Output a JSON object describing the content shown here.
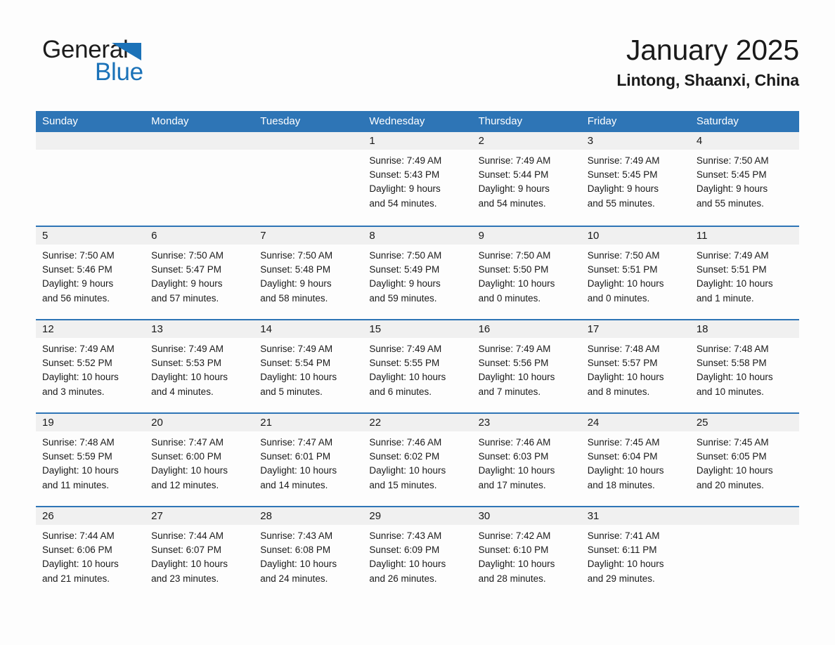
{
  "brand": {
    "name_part1": "General",
    "name_part2": "Blue",
    "triangle_icon": "triangle-icon",
    "accent_color": "#1b72b8"
  },
  "header": {
    "title": "January 2025",
    "subtitle": "Lintong, Shaanxi, China",
    "header_bg_color": "#2e75b6",
    "day_strip_color": "#f0f0f0"
  },
  "weekdays": [
    "Sunday",
    "Monday",
    "Tuesday",
    "Wednesday",
    "Thursday",
    "Friday",
    "Saturday"
  ],
  "weeks": [
    [
      {
        "date": "",
        "sunrise": "",
        "sunset": "",
        "daylight_line1": "",
        "daylight_line2": ""
      },
      {
        "date": "",
        "sunrise": "",
        "sunset": "",
        "daylight_line1": "",
        "daylight_line2": ""
      },
      {
        "date": "",
        "sunrise": "",
        "sunset": "",
        "daylight_line1": "",
        "daylight_line2": ""
      },
      {
        "date": "1",
        "sunrise": "Sunrise: 7:49 AM",
        "sunset": "Sunset: 5:43 PM",
        "daylight_line1": "Daylight: 9 hours",
        "daylight_line2": "and 54 minutes."
      },
      {
        "date": "2",
        "sunrise": "Sunrise: 7:49 AM",
        "sunset": "Sunset: 5:44 PM",
        "daylight_line1": "Daylight: 9 hours",
        "daylight_line2": "and 54 minutes."
      },
      {
        "date": "3",
        "sunrise": "Sunrise: 7:49 AM",
        "sunset": "Sunset: 5:45 PM",
        "daylight_line1": "Daylight: 9 hours",
        "daylight_line2": "and 55 minutes."
      },
      {
        "date": "4",
        "sunrise": "Sunrise: 7:50 AM",
        "sunset": "Sunset: 5:45 PM",
        "daylight_line1": "Daylight: 9 hours",
        "daylight_line2": "and 55 minutes."
      }
    ],
    [
      {
        "date": "5",
        "sunrise": "Sunrise: 7:50 AM",
        "sunset": "Sunset: 5:46 PM",
        "daylight_line1": "Daylight: 9 hours",
        "daylight_line2": "and 56 minutes."
      },
      {
        "date": "6",
        "sunrise": "Sunrise: 7:50 AM",
        "sunset": "Sunset: 5:47 PM",
        "daylight_line1": "Daylight: 9 hours",
        "daylight_line2": "and 57 minutes."
      },
      {
        "date": "7",
        "sunrise": "Sunrise: 7:50 AM",
        "sunset": "Sunset: 5:48 PM",
        "daylight_line1": "Daylight: 9 hours",
        "daylight_line2": "and 58 minutes."
      },
      {
        "date": "8",
        "sunrise": "Sunrise: 7:50 AM",
        "sunset": "Sunset: 5:49 PM",
        "daylight_line1": "Daylight: 9 hours",
        "daylight_line2": "and 59 minutes."
      },
      {
        "date": "9",
        "sunrise": "Sunrise: 7:50 AM",
        "sunset": "Sunset: 5:50 PM",
        "daylight_line1": "Daylight: 10 hours",
        "daylight_line2": "and 0 minutes."
      },
      {
        "date": "10",
        "sunrise": "Sunrise: 7:50 AM",
        "sunset": "Sunset: 5:51 PM",
        "daylight_line1": "Daylight: 10 hours",
        "daylight_line2": "and 0 minutes."
      },
      {
        "date": "11",
        "sunrise": "Sunrise: 7:49 AM",
        "sunset": "Sunset: 5:51 PM",
        "daylight_line1": "Daylight: 10 hours",
        "daylight_line2": "and 1 minute."
      }
    ],
    [
      {
        "date": "12",
        "sunrise": "Sunrise: 7:49 AM",
        "sunset": "Sunset: 5:52 PM",
        "daylight_line1": "Daylight: 10 hours",
        "daylight_line2": "and 3 minutes."
      },
      {
        "date": "13",
        "sunrise": "Sunrise: 7:49 AM",
        "sunset": "Sunset: 5:53 PM",
        "daylight_line1": "Daylight: 10 hours",
        "daylight_line2": "and 4 minutes."
      },
      {
        "date": "14",
        "sunrise": "Sunrise: 7:49 AM",
        "sunset": "Sunset: 5:54 PM",
        "daylight_line1": "Daylight: 10 hours",
        "daylight_line2": "and 5 minutes."
      },
      {
        "date": "15",
        "sunrise": "Sunrise: 7:49 AM",
        "sunset": "Sunset: 5:55 PM",
        "daylight_line1": "Daylight: 10 hours",
        "daylight_line2": "and 6 minutes."
      },
      {
        "date": "16",
        "sunrise": "Sunrise: 7:49 AM",
        "sunset": "Sunset: 5:56 PM",
        "daylight_line1": "Daylight: 10 hours",
        "daylight_line2": "and 7 minutes."
      },
      {
        "date": "17",
        "sunrise": "Sunrise: 7:48 AM",
        "sunset": "Sunset: 5:57 PM",
        "daylight_line1": "Daylight: 10 hours",
        "daylight_line2": "and 8 minutes."
      },
      {
        "date": "18",
        "sunrise": "Sunrise: 7:48 AM",
        "sunset": "Sunset: 5:58 PM",
        "daylight_line1": "Daylight: 10 hours",
        "daylight_line2": "and 10 minutes."
      }
    ],
    [
      {
        "date": "19",
        "sunrise": "Sunrise: 7:48 AM",
        "sunset": "Sunset: 5:59 PM",
        "daylight_line1": "Daylight: 10 hours",
        "daylight_line2": "and 11 minutes."
      },
      {
        "date": "20",
        "sunrise": "Sunrise: 7:47 AM",
        "sunset": "Sunset: 6:00 PM",
        "daylight_line1": "Daylight: 10 hours",
        "daylight_line2": "and 12 minutes."
      },
      {
        "date": "21",
        "sunrise": "Sunrise: 7:47 AM",
        "sunset": "Sunset: 6:01 PM",
        "daylight_line1": "Daylight: 10 hours",
        "daylight_line2": "and 14 minutes."
      },
      {
        "date": "22",
        "sunrise": "Sunrise: 7:46 AM",
        "sunset": "Sunset: 6:02 PM",
        "daylight_line1": "Daylight: 10 hours",
        "daylight_line2": "and 15 minutes."
      },
      {
        "date": "23",
        "sunrise": "Sunrise: 7:46 AM",
        "sunset": "Sunset: 6:03 PM",
        "daylight_line1": "Daylight: 10 hours",
        "daylight_line2": "and 17 minutes."
      },
      {
        "date": "24",
        "sunrise": "Sunrise: 7:45 AM",
        "sunset": "Sunset: 6:04 PM",
        "daylight_line1": "Daylight: 10 hours",
        "daylight_line2": "and 18 minutes."
      },
      {
        "date": "25",
        "sunrise": "Sunrise: 7:45 AM",
        "sunset": "Sunset: 6:05 PM",
        "daylight_line1": "Daylight: 10 hours",
        "daylight_line2": "and 20 minutes."
      }
    ],
    [
      {
        "date": "26",
        "sunrise": "Sunrise: 7:44 AM",
        "sunset": "Sunset: 6:06 PM",
        "daylight_line1": "Daylight: 10 hours",
        "daylight_line2": "and 21 minutes."
      },
      {
        "date": "27",
        "sunrise": "Sunrise: 7:44 AM",
        "sunset": "Sunset: 6:07 PM",
        "daylight_line1": "Daylight: 10 hours",
        "daylight_line2": "and 23 minutes."
      },
      {
        "date": "28",
        "sunrise": "Sunrise: 7:43 AM",
        "sunset": "Sunset: 6:08 PM",
        "daylight_line1": "Daylight: 10 hours",
        "daylight_line2": "and 24 minutes."
      },
      {
        "date": "29",
        "sunrise": "Sunrise: 7:43 AM",
        "sunset": "Sunset: 6:09 PM",
        "daylight_line1": "Daylight: 10 hours",
        "daylight_line2": "and 26 minutes."
      },
      {
        "date": "30",
        "sunrise": "Sunrise: 7:42 AM",
        "sunset": "Sunset: 6:10 PM",
        "daylight_line1": "Daylight: 10 hours",
        "daylight_line2": "and 28 minutes."
      },
      {
        "date": "31",
        "sunrise": "Sunrise: 7:41 AM",
        "sunset": "Sunset: 6:11 PM",
        "daylight_line1": "Daylight: 10 hours",
        "daylight_line2": "and 29 minutes."
      },
      {
        "date": "",
        "sunrise": "",
        "sunset": "",
        "daylight_line1": "",
        "daylight_line2": ""
      }
    ]
  ]
}
